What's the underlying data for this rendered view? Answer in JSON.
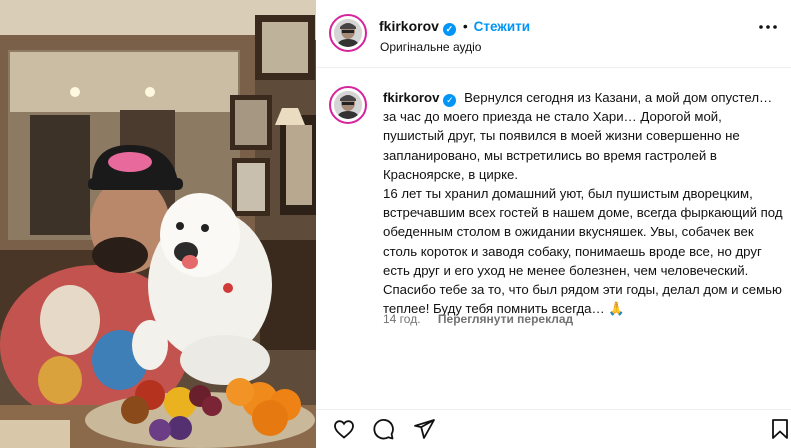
{
  "header": {
    "username": "fkirkorov",
    "separator": "•",
    "follow_label": "Стежити",
    "audio_label": "Оригінальне аудіо",
    "more_icon": "more-horizontal-icon"
  },
  "post": {
    "username": "fkirkorov",
    "paragraph1": "Вернулся сегодня из Казани, а мой дом опустел… за час до моего приезда не стало Хари… Дорогой мой, пушистый друг, ты появился в моей жизни совершенно не запланировано, мы встретились во время гастролей в Красноярске, в цирке.",
    "paragraph2": "16 лет ты хранил домашний уют, был пушистым дворецким, встречавшим всех гостей в нашем доме, всегда фыркающий под обеденным столом в ожидании вкусняшек. Увы, собачек век столь короток и заводя собаку, понимаешь вроде все, но друг есть друг и его уход не менее болезнен, чем человеческий. Спасибо тебе за то, что был рядом эти годы, делал дом и семью теплее! Буду тебя помнить всегда… 🙏",
    "time": "14 год.",
    "translate_label": "Переглянути переклад"
  },
  "colors": {
    "accent": "#0095f6",
    "verified": "#0095f6",
    "meta": "#737373"
  },
  "actions": [
    "heart-icon",
    "comment-icon",
    "share-icon",
    "bookmark-icon"
  ]
}
